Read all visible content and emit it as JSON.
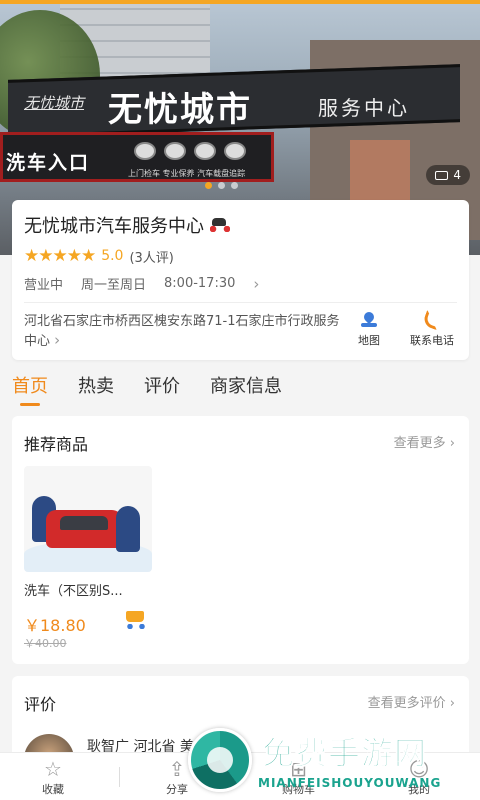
{
  "banner": {
    "sign_logo": "无忧城市",
    "sign_name": "无忧城市",
    "sign_sub": "服务中心",
    "wash_entrance": "洗车入口",
    "brand_tagline": "上门检车 专业保养 汽车载盘追踪",
    "photo_count": "4"
  },
  "shop": {
    "name": "无忧城市汽车服务中心",
    "stars": "★★★★★",
    "score": "5.0",
    "review_count": "(3人评)",
    "status": "营业中",
    "days": "周一至周日",
    "hours": "8:00-17:30",
    "address": "河北省石家庄市桥西区槐安东路71-1石家庄市行政服务中心",
    "map_label": "地图",
    "phone_label": "联系电话"
  },
  "tabs": [
    {
      "label": "首页",
      "active": true
    },
    {
      "label": "热卖",
      "active": false
    },
    {
      "label": "评价",
      "active": false
    },
    {
      "label": "商家信息",
      "active": false
    }
  ],
  "recommended": {
    "title": "推荐商品",
    "more": "查看更多",
    "product": {
      "name": "洗车（不区别S...",
      "price": "￥18.80",
      "old_price": "￥40.00"
    }
  },
  "reviews": {
    "title": "评价",
    "more": "查看更多评价",
    "first_line": "耿智广 河北省 美容"
  },
  "bottom_bar": {
    "collect": "收藏",
    "share": "分享",
    "cart": "购物车",
    "mine": "我的"
  },
  "watermark": {
    "title": "免费手游网",
    "url": "MIANFEISHOUYOUWANG"
  },
  "colors": {
    "accent": "#f08a1c",
    "star": "#f5a623",
    "map_blue": "#3c7bd9"
  }
}
